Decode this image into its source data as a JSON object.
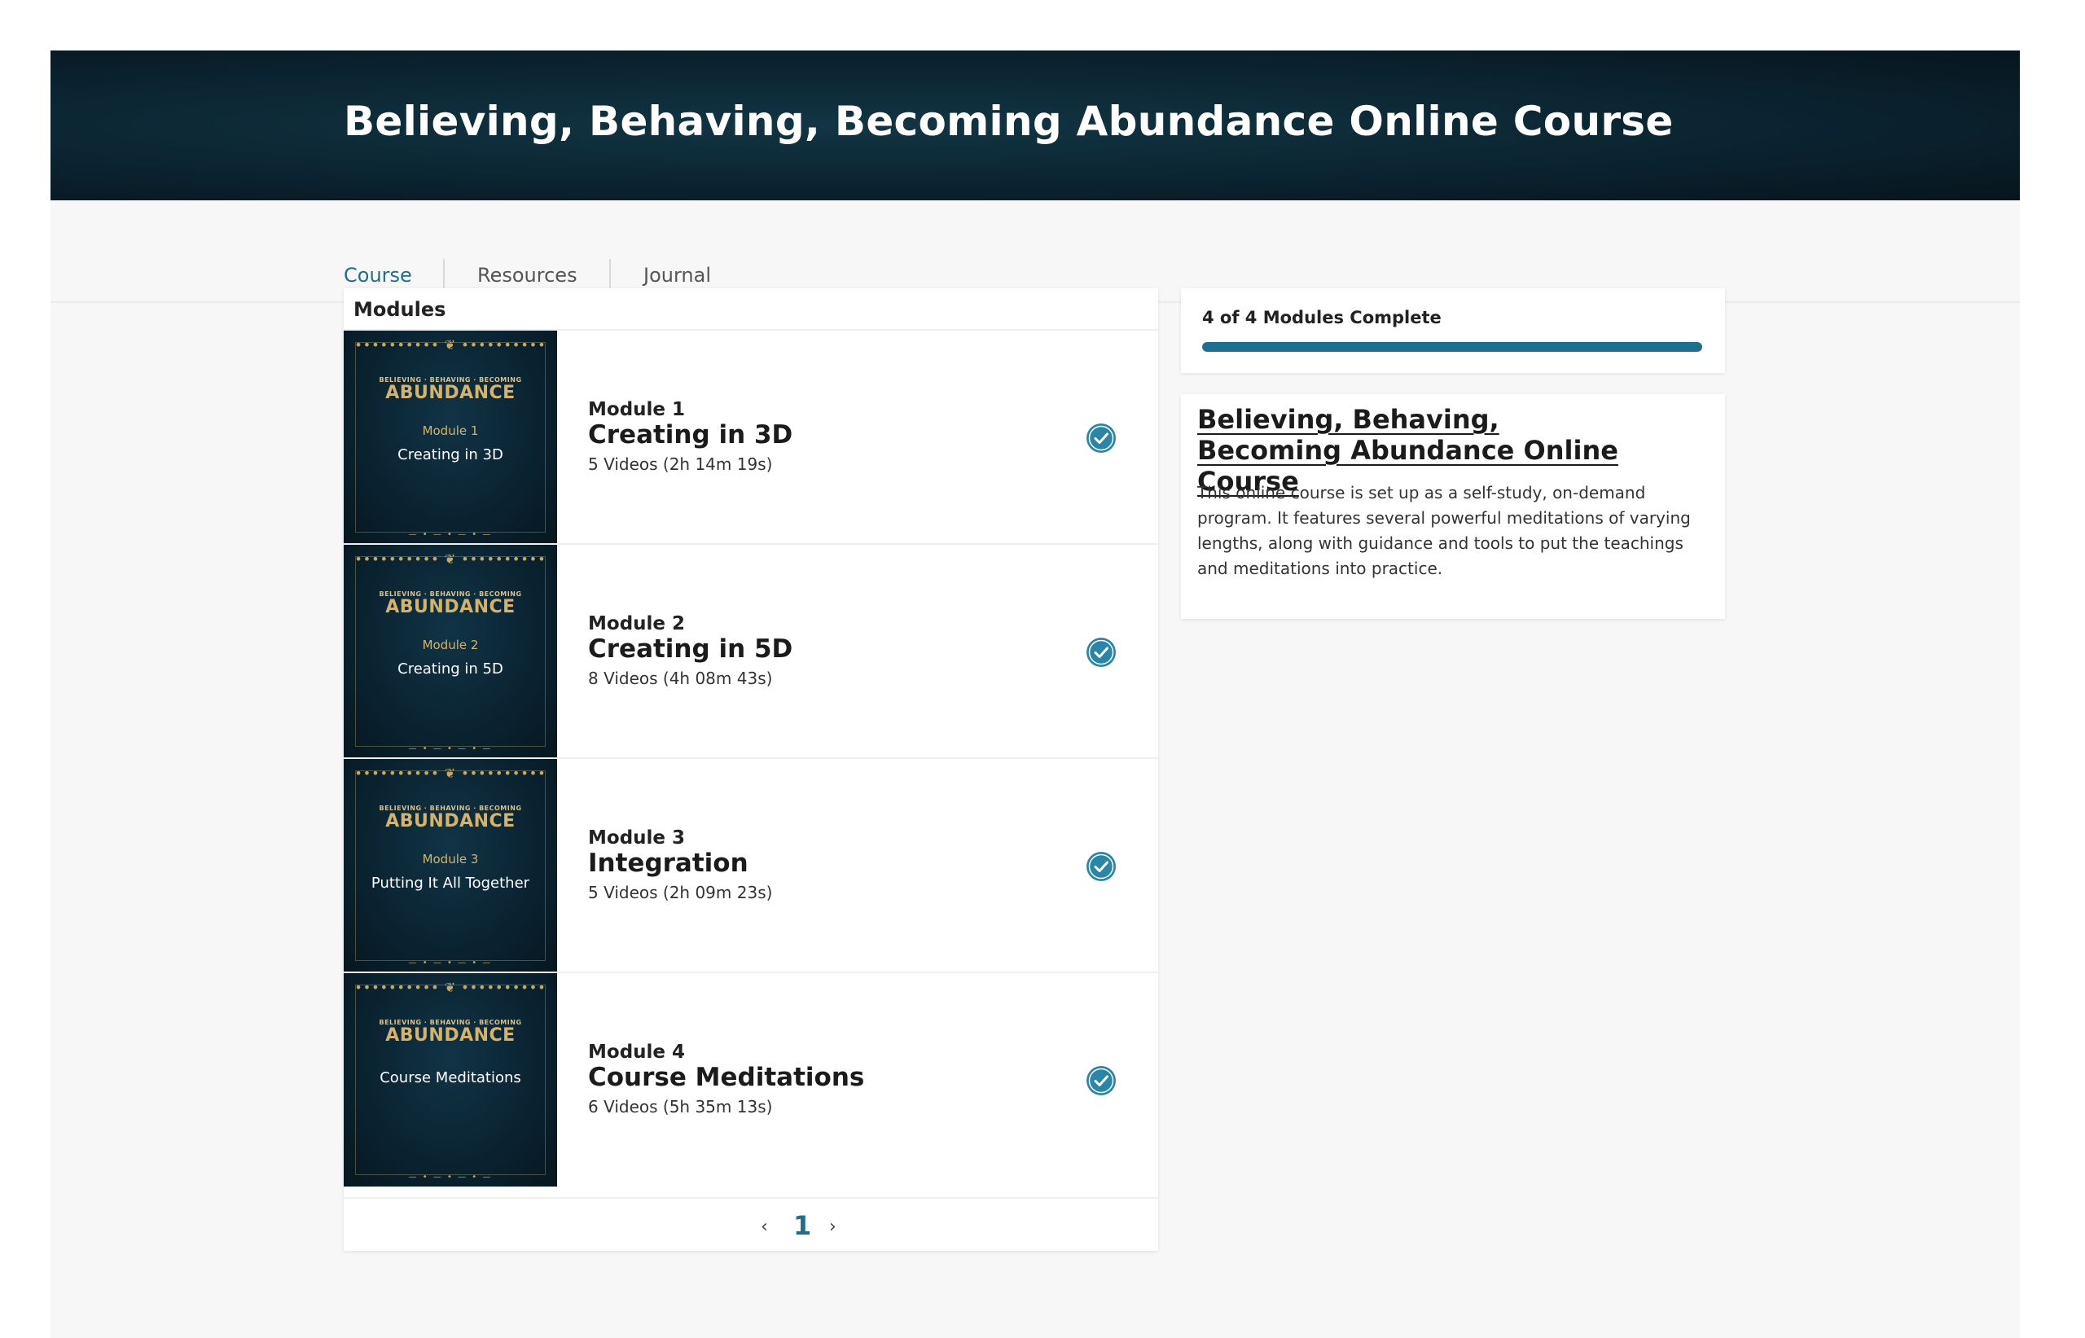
{
  "banner": {
    "title": "Believing, Behaving, Becoming Abundance Online Course"
  },
  "tabs": [
    {
      "label": "Course",
      "active": true
    },
    {
      "label": "Resources",
      "active": false
    },
    {
      "label": "Journal",
      "active": false
    }
  ],
  "modules": {
    "header": "Modules",
    "items": [
      {
        "thumb_kicker": "BELIEVING · BEHAVING · BECOMING",
        "thumb_brand": "ABUNDANCE",
        "thumb_mod": "Module 1",
        "thumb_name": "Creating in 3D",
        "label": "Module 1",
        "title": "Creating in 3D",
        "meta": "5 Videos (2h 14m 19s)",
        "complete": true
      },
      {
        "thumb_kicker": "BELIEVING · BEHAVING · BECOMING",
        "thumb_brand": "ABUNDANCE",
        "thumb_mod": "Module 2",
        "thumb_name": "Creating in 5D",
        "label": "Module 2",
        "title": "Creating in 5D",
        "meta": "8 Videos (4h 08m 43s)",
        "complete": true
      },
      {
        "thumb_kicker": "BELIEVING · BEHAVING · BECOMING",
        "thumb_brand": "ABUNDANCE",
        "thumb_mod": "Module 3",
        "thumb_name": "Putting It All Together",
        "label": "Module 3",
        "title": "Integration",
        "meta": "5 Videos (2h 09m 23s)",
        "complete": true
      },
      {
        "thumb_kicker": "BELIEVING · BEHAVING · BECOMING",
        "thumb_brand": "ABUNDANCE",
        "thumb_mod": "",
        "thumb_name": "Course Meditations",
        "label": "Module 4",
        "title": "Course Meditations",
        "meta": "6 Videos (5h 35m 13s)",
        "complete": true
      }
    ]
  },
  "pagination": {
    "prev": "‹",
    "current": "1",
    "next": "›"
  },
  "progress": {
    "label": "4 of 4 Modules Complete",
    "fraction": 1.0
  },
  "about": {
    "title": "Believing, Behaving, Becoming Abundance Online Course",
    "description": "This online course is set up as a self-study, on-demand program. It features several powerful meditations of varying lengths, along with guidance and tools to put the teachings and meditations into practice."
  },
  "colors": {
    "accent": "#1f6f8b",
    "progress": "#1d6f90",
    "check": "#2a86a8",
    "banner": "#0b2431",
    "gold": "#d7b36a"
  }
}
